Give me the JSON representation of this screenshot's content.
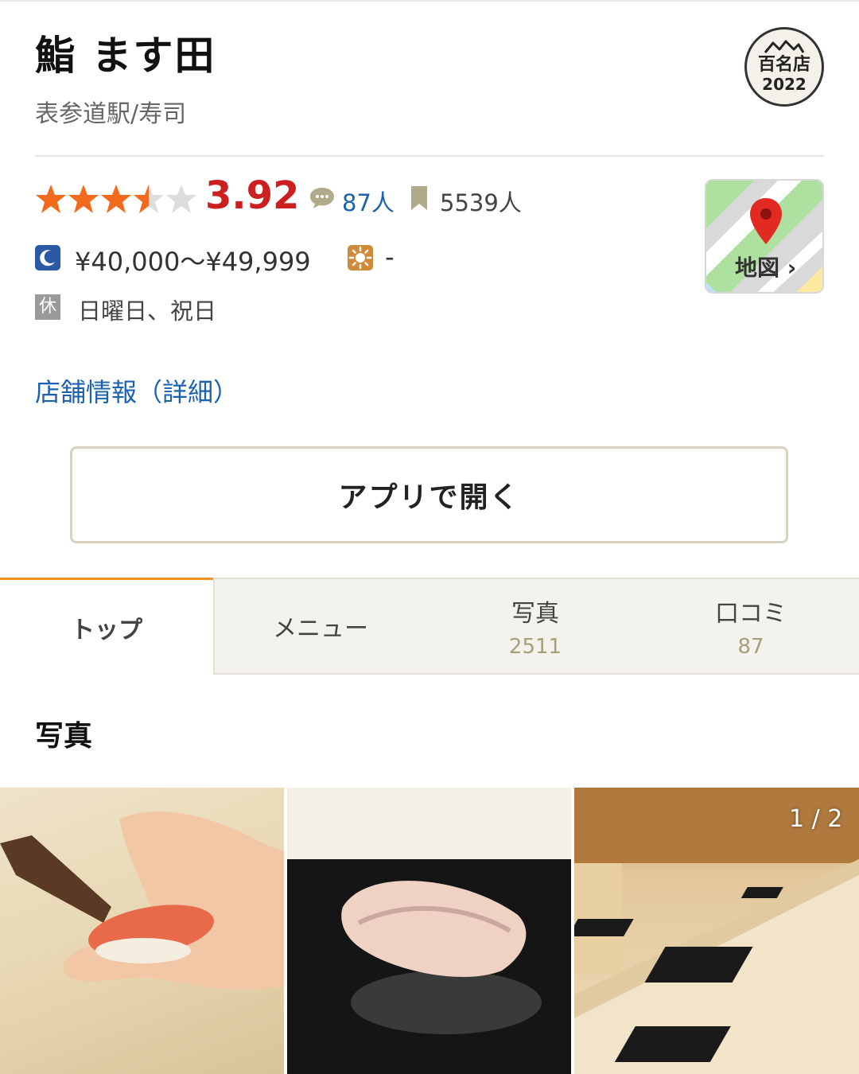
{
  "restaurant": {
    "name": "鮨 ます田",
    "subtitle": "表参道駅/寿司"
  },
  "badge": {
    "line1": "百名店",
    "line2": "2022"
  },
  "rating": {
    "stars": 3.92,
    "score": "3.92",
    "reviews": "87人",
    "bookmarks": "5539人"
  },
  "price": {
    "dinner": "¥40,000～¥49,999",
    "lunch": "-"
  },
  "holiday": {
    "icon_label": "休",
    "text": "日曜日、祝日"
  },
  "map": {
    "label": "地図 ›"
  },
  "links": {
    "detail": "店舗情報（詳細）"
  },
  "buttons": {
    "open_app": "アプリで開く"
  },
  "tabs": [
    {
      "label": "トップ",
      "count": ""
    },
    {
      "label": "メニュー",
      "count": ""
    },
    {
      "label": "写真",
      "count": "2511"
    },
    {
      "label": "口コミ",
      "count": "87"
    }
  ],
  "photos": {
    "section_title": "写真",
    "counter": "1 / 2"
  },
  "colors": {
    "score": "#cc1f1f",
    "star": "#f26a1b",
    "link": "#1b61b0",
    "tab_active": "#f29020"
  },
  "icons": [
    "review-bubble-icon",
    "bookmark-icon",
    "moon-icon",
    "sun-icon",
    "map-pin-icon",
    "mountain-icon"
  ]
}
